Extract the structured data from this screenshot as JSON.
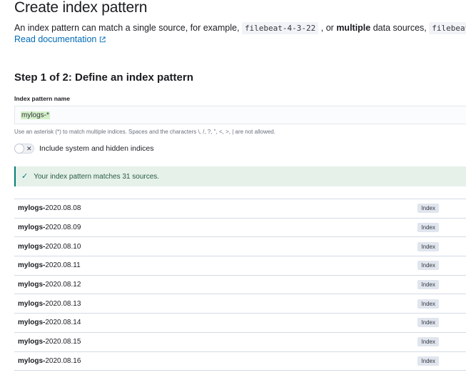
{
  "header": {
    "title": "Create index pattern",
    "description_parts": {
      "p1": "An index pattern can match a single source, for example,",
      "code1": "filebeat-4-3-22",
      "p2": ", or",
      "bold": "multiple",
      "p3": "data sources,",
      "code2": "filebeat-*",
      "p4": "."
    },
    "read_docs_link": "Read documentation"
  },
  "step": {
    "title": "Step 1 of 2: Define an index pattern",
    "field_label": "Index pattern name",
    "field_value": "mylogs-*",
    "help_text": "Use an asterisk (*) to match multiple indices. Spaces and the characters \\, /, ?, \", <, >, | are not allowed.",
    "toggle_label": "Include system and hidden indices",
    "toggle_state": "off"
  },
  "callout": {
    "text": "Your index pattern matches 31 sources.",
    "color": "#017d73"
  },
  "sources": {
    "rows": [
      {
        "prefix": "mylogs-",
        "suffix": "2020.08.08",
        "badge": "Index"
      },
      {
        "prefix": "mylogs-",
        "suffix": "2020.08.09",
        "badge": "Index"
      },
      {
        "prefix": "mylogs-",
        "suffix": "2020.08.10",
        "badge": "Index"
      },
      {
        "prefix": "mylogs-",
        "suffix": "2020.08.11",
        "badge": "Index"
      },
      {
        "prefix": "mylogs-",
        "suffix": "2020.08.12",
        "badge": "Index"
      },
      {
        "prefix": "mylogs-",
        "suffix": "2020.08.13",
        "badge": "Index"
      },
      {
        "prefix": "mylogs-",
        "suffix": "2020.08.14",
        "badge": "Index"
      },
      {
        "prefix": "mylogs-",
        "suffix": "2020.08.15",
        "badge": "Index"
      },
      {
        "prefix": "mylogs-",
        "suffix": "2020.08.16",
        "badge": "Index"
      }
    ]
  }
}
